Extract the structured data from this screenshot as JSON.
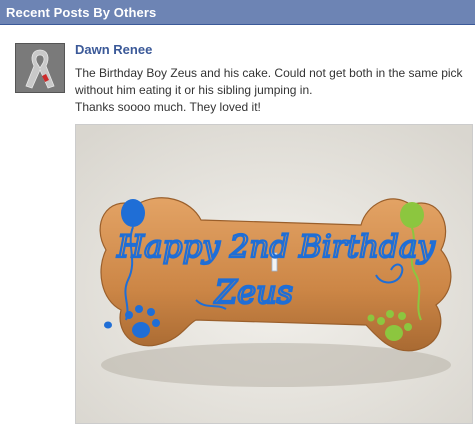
{
  "header": {
    "title": "Recent Posts By Others"
  },
  "post": {
    "author": "Dawn Renee",
    "message_lines": [
      "The Birthday Boy Zeus and his cake. Could not get both in the same pick without him eating it or his sibling jumping in.",
      "Thanks soooo much. They loved it!"
    ],
    "photo": {
      "icing_line1": "Happy 2nd Birthday",
      "icing_line2": "Zeus"
    }
  },
  "colors": {
    "header_bg": "#6d84b4",
    "author_link": "#3b5998",
    "cake": "#d18a4a",
    "icing_blue": "#1f6ed6",
    "icing_green": "#8cc63f"
  },
  "icons": {
    "avatar": "awareness-ribbon-icon"
  }
}
